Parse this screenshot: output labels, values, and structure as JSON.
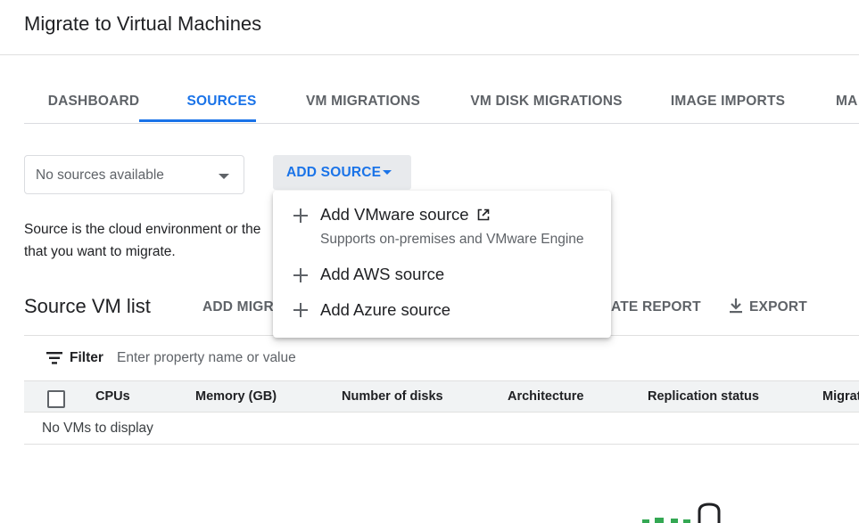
{
  "header": {
    "title": "Migrate to Virtual Machines"
  },
  "tabs": [
    {
      "label": "DASHBOARD",
      "active": false
    },
    {
      "label": "SOURCES",
      "active": true
    },
    {
      "label": "VM MIGRATIONS",
      "active": false
    },
    {
      "label": "VM DISK MIGRATIONS",
      "active": false
    },
    {
      "label": "IMAGE IMPORTS",
      "active": false
    },
    {
      "label": "MA",
      "active": false
    }
  ],
  "source_selector": {
    "value": "No sources available"
  },
  "add_source": {
    "label": "ADD SOURCE",
    "menu": [
      {
        "label": "Add VMware source",
        "sublabel": "Supports on-premises and VMware Engine",
        "icon": "open-in-new-icon"
      },
      {
        "label": "Add AWS source"
      },
      {
        "label": "Add Azure source"
      }
    ]
  },
  "description": {
    "line1": "Source is the cloud environment or the",
    "line2": "that you want to migrate."
  },
  "source_vm_list": {
    "title": "Source VM list",
    "add_migration_label": "ADD MIGRA",
    "create_report_label": "ATE REPORT",
    "export_label": "EXPORT"
  },
  "filter": {
    "label": "Filter",
    "placeholder": "Enter property name or value"
  },
  "table": {
    "columns": [
      "CPUs",
      "Memory (GB)",
      "Number of disks",
      "Architecture",
      "Replication status",
      "Migrat"
    ],
    "empty_text": "No VMs to display"
  },
  "colors": {
    "accent": "#1a73e8",
    "text_secondary": "#5f6368",
    "header_bg": "#f1f3f4"
  }
}
